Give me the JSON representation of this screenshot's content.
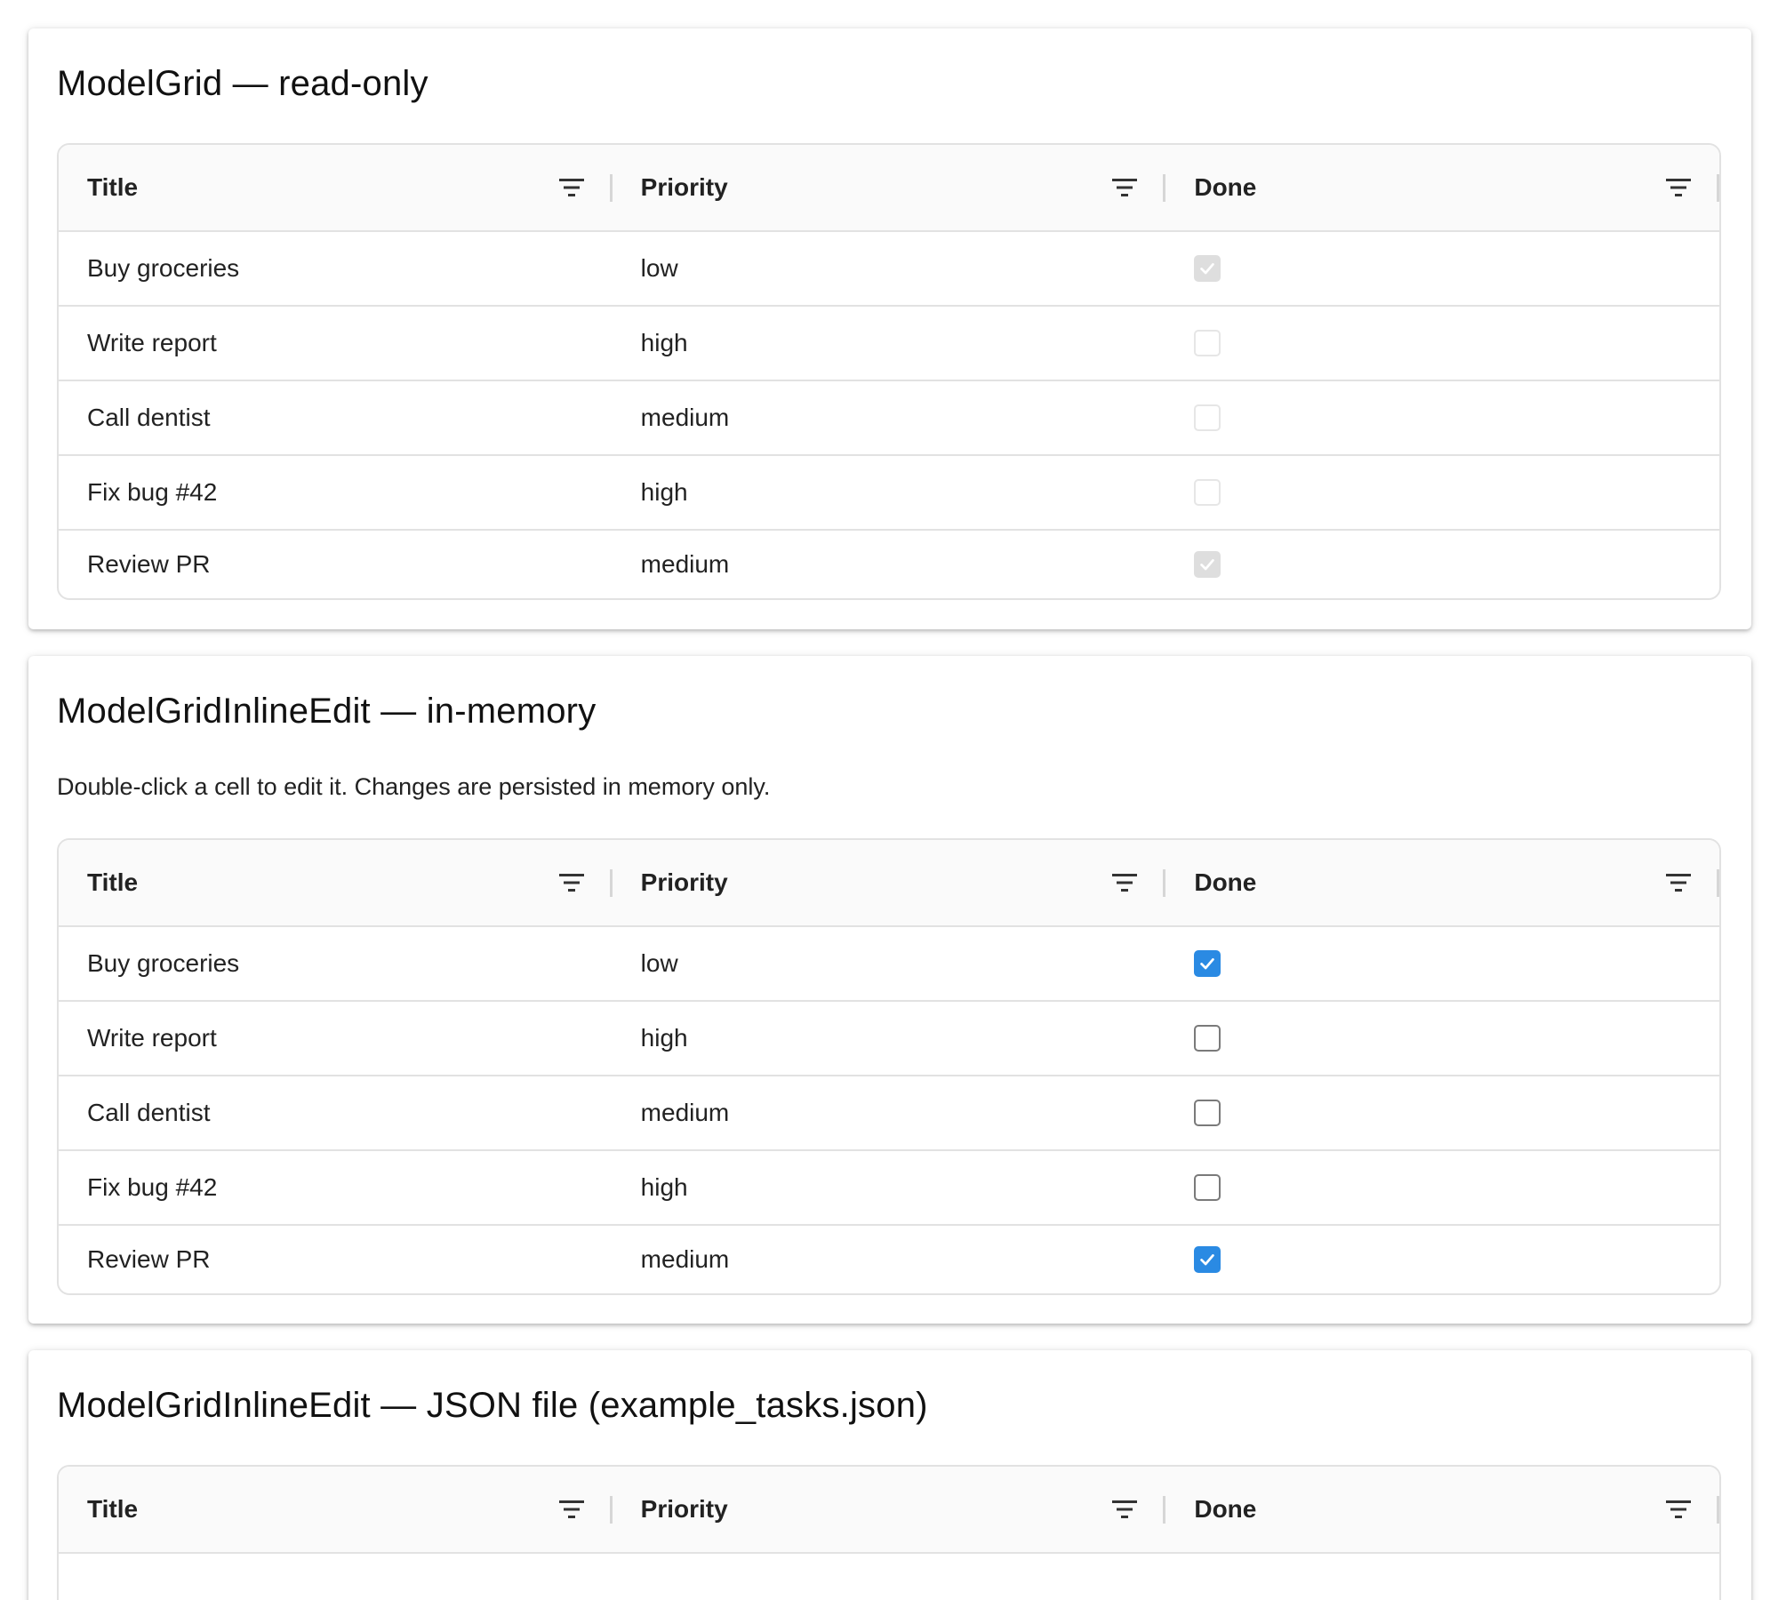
{
  "sections": [
    {
      "title": "ModelGrid — read-only",
      "description": "",
      "columns": [
        "Title",
        "Priority",
        "Done"
      ],
      "rows": [
        {
          "title": "Buy groceries",
          "priority": "low",
          "done": true
        },
        {
          "title": "Write report",
          "priority": "high",
          "done": false
        },
        {
          "title": "Call dentist",
          "priority": "medium",
          "done": false
        },
        {
          "title": "Fix bug #42",
          "priority": "high",
          "done": false
        },
        {
          "title": "Review PR",
          "priority": "medium",
          "done": true
        }
      ]
    },
    {
      "title": "ModelGridInlineEdit — in-memory",
      "description": "Double-click a cell to edit it. Changes are persisted in memory only.",
      "columns": [
        "Title",
        "Priority",
        "Done"
      ],
      "rows": [
        {
          "title": "Buy groceries",
          "priority": "low",
          "done": true
        },
        {
          "title": "Write report",
          "priority": "high",
          "done": false
        },
        {
          "title": "Call dentist",
          "priority": "medium",
          "done": false
        },
        {
          "title": "Fix bug #42",
          "priority": "high",
          "done": false
        },
        {
          "title": "Review PR",
          "priority": "medium",
          "done": true
        }
      ]
    },
    {
      "title": "ModelGridInlineEdit — JSON file (example_tasks.json)",
      "description": "",
      "columns": [
        "Title",
        "Priority",
        "Done"
      ],
      "rows": []
    }
  ],
  "colors": {
    "checkbox_checked": "#2a8ae3",
    "checkbox_disabled": "#dedede",
    "border": "#e2e2e2",
    "header_bg": "#fafafa"
  },
  "icons": {
    "column_menu": "filter-icon",
    "check": "check-icon"
  }
}
